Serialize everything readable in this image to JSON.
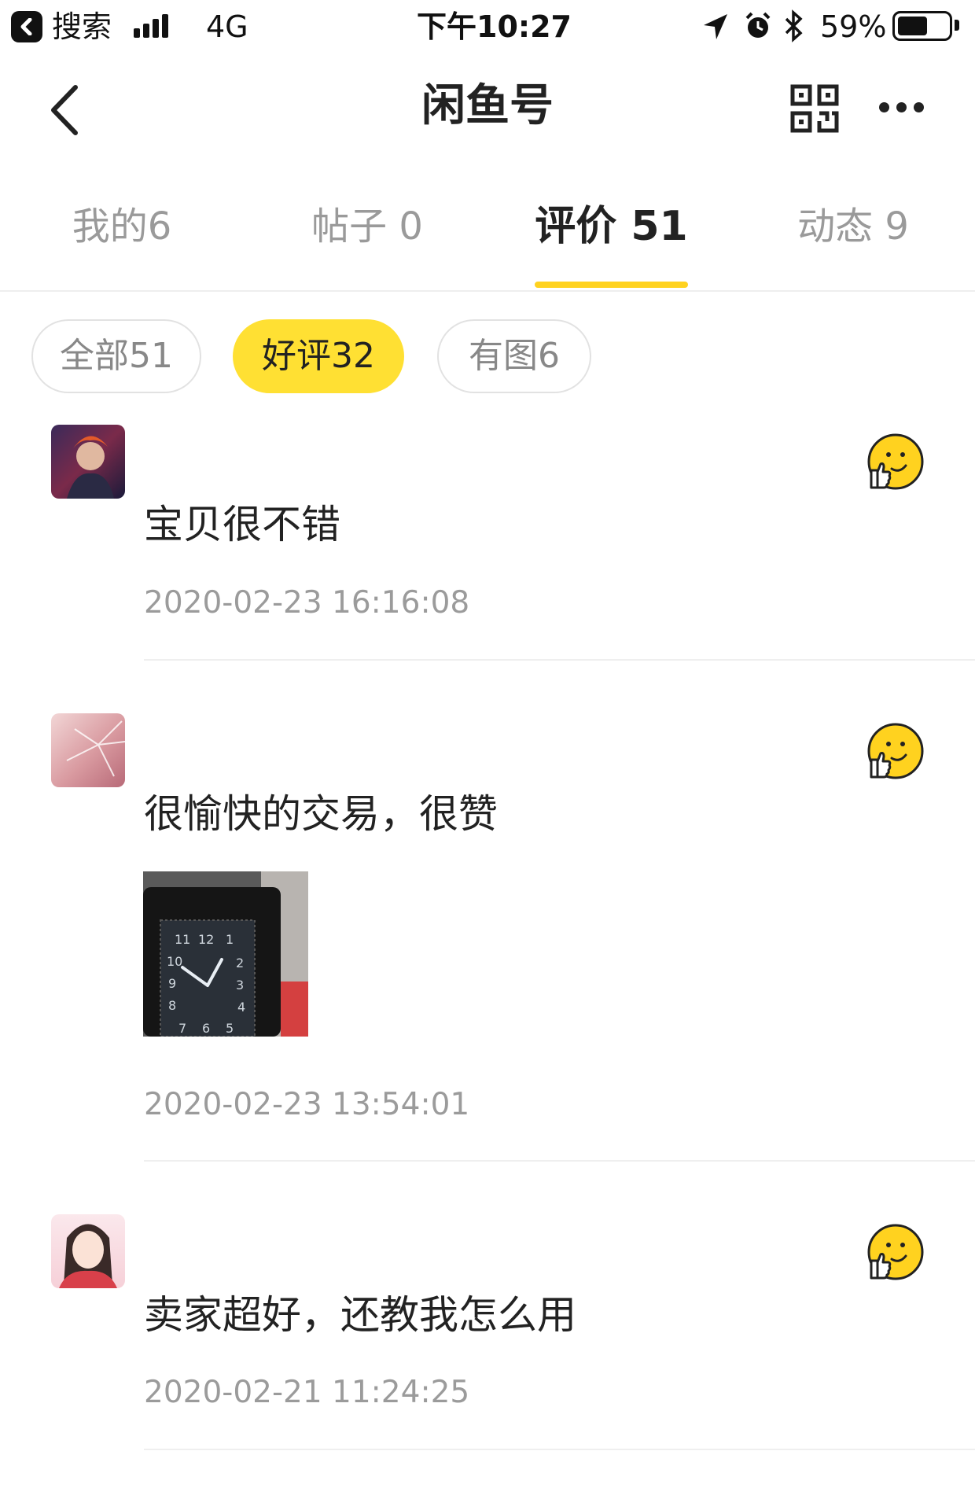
{
  "status_bar": {
    "back_label": "搜索",
    "network": "4G",
    "time": "下午10:27",
    "battery_text": "59%",
    "battery_level": 0.59
  },
  "nav": {
    "title": "闲鱼号"
  },
  "tabs": [
    {
      "label": "我的6",
      "active": false
    },
    {
      "label": "帖子 0",
      "active": false
    },
    {
      "label": "评价 51",
      "active": true
    },
    {
      "label": "动态 9",
      "active": false
    }
  ],
  "filters": [
    {
      "label": "全部51",
      "active": false
    },
    {
      "label": "好评32",
      "active": true
    },
    {
      "label": "有图6",
      "active": false
    }
  ],
  "reviews": [
    {
      "text": "宝贝很不错",
      "time": "2020-02-23 16:16:08",
      "has_image": false,
      "reaction_icon": "thumbs-up-smiley-icon"
    },
    {
      "text": "很愉快的交易，很赞",
      "time": "2020-02-23 13:54:01",
      "has_image": true,
      "reaction_icon": "thumbs-up-smiley-icon"
    },
    {
      "text": "卖家超好，还教我怎么用",
      "time": "2020-02-21 11:24:25",
      "has_image": false,
      "reaction_icon": "thumbs-up-smiley-icon"
    }
  ],
  "colors": {
    "accent": "#ffd21f",
    "chip_active": "#ffe033"
  }
}
